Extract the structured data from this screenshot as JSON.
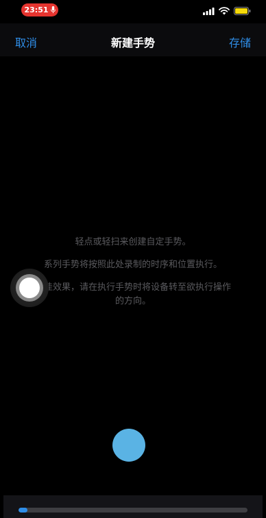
{
  "status_bar": {
    "time": "23:51",
    "icons": [
      "mic-icon",
      "signal-icon",
      "wifi-icon",
      "battery-icon"
    ],
    "pill_color": "#e5342f",
    "battery_color": "#f5d90a"
  },
  "nav": {
    "cancel_label": "取消",
    "title": "新建手势",
    "save_label": "存储",
    "accent_color": "#2f8ee8"
  },
  "instructions": {
    "line1": "轻点或轻扫来创建自定手势。",
    "line2": "系列手势将按照此处录制的时序和位置执行。",
    "line3": "最佳效果，请在执行手势时将设备转至欲执行操作的方向。"
  },
  "touch_point": {
    "color": "#5ab3e4"
  },
  "progress": {
    "value": 0.04
  }
}
